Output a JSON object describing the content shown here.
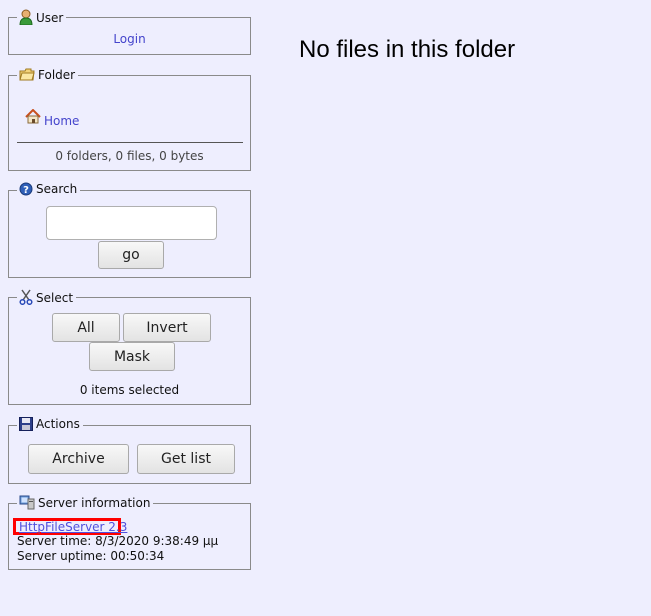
{
  "user": {
    "legend": "User",
    "login_link": "Login"
  },
  "folder": {
    "legend": "Folder",
    "home_link": "Home",
    "stats": "0 folders, 0 files, 0 bytes"
  },
  "search": {
    "legend": "Search",
    "input_value": "",
    "go_label": "go"
  },
  "select": {
    "legend": "Select",
    "all_label": "All",
    "invert_label": "Invert",
    "mask_label": "Mask",
    "status": "0 items selected"
  },
  "actions": {
    "legend": "Actions",
    "archive_label": "Archive",
    "getlist_label": "Get list"
  },
  "server": {
    "legend": "Server information",
    "link": "HttpFileServer 2.3",
    "time": "Server time: 8/3/2020 9:38:49 μμ",
    "uptime": "Server uptime: 00:50:34"
  },
  "main": {
    "message": "No files in this folder"
  },
  "colors": {
    "background": "#eeeefe",
    "link": "#4444cc",
    "highlight": "#ff0000"
  }
}
